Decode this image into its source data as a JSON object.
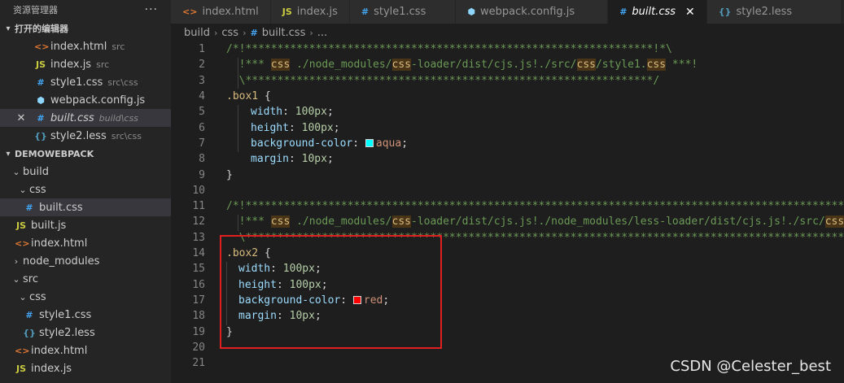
{
  "sidebar": {
    "title": "资源管理器",
    "more": "···",
    "open_editors_label": "打开的编辑器",
    "open_editors": [
      {
        "icon": "<>",
        "name": "index.html",
        "desc": "src"
      },
      {
        "icon": "JS",
        "name": "index.js",
        "desc": "src"
      },
      {
        "icon": "#",
        "name": "style1.css",
        "desc": "src\\css"
      },
      {
        "icon": "⬢",
        "name": "webpack.config.js",
        "desc": ""
      },
      {
        "icon": "#",
        "name": "built.css",
        "desc": "build\\css"
      },
      {
        "icon": "{}",
        "name": "style2.less",
        "desc": "src\\css"
      }
    ],
    "project_label": "DEMOWEBPACK",
    "tree": [
      {
        "name": "build"
      },
      {
        "name": "css"
      },
      {
        "name": "built.css",
        "icon": "#"
      },
      {
        "name": "built.js",
        "icon": "JS"
      },
      {
        "name": "index.html",
        "icon": "<>"
      },
      {
        "name": "node_modules"
      },
      {
        "name": "src"
      },
      {
        "name": "css"
      },
      {
        "name": "style1.css",
        "icon": "#"
      },
      {
        "name": "style2.less",
        "icon": "{}"
      },
      {
        "name": "index.html",
        "icon": "<>"
      },
      {
        "name": "index.js",
        "icon": "JS"
      }
    ]
  },
  "tabs": [
    {
      "icon": "<>",
      "label": "index.html"
    },
    {
      "icon": "JS",
      "label": "index.js"
    },
    {
      "icon": "#",
      "label": "style1.css"
    },
    {
      "icon": "⬢",
      "label": "webpack.config.js"
    },
    {
      "icon": "#",
      "label": "built.css",
      "close": "✕"
    },
    {
      "icon": "{}",
      "label": "style2.less"
    }
  ],
  "breadcrumb": {
    "p1": "build",
    "sep": "›",
    "p2": "css",
    "icon": "#",
    "p3": "built.css",
    "p4": "..."
  },
  "code": {
    "l1": "/*!****************************************************************!*\\",
    "l2a": "  !*** ",
    "l2b": "css",
    "l2c": " ./node_modules/",
    "l2d": "css",
    "l2e": "-loader/dist/cjs.js!./src/",
    "l2f": "css",
    "l2g": "/style1.",
    "l2h": "css",
    "l2i": " ***!",
    "l3": "  \\****************************************************************/",
    "l4sel": ".box1",
    "l4pun": " {",
    "l5p": "width",
    "l5v": "100px",
    "l6p": "height",
    "l6v": "100px",
    "l7p": "background-color",
    "l7v": "aqua",
    "l8p": "margin",
    "l8v": "10px",
    "l9": "}",
    "l11": "/*!*************************************************************************************************************",
    "l12a": "  !*** ",
    "l12b": "css",
    "l12c": " ./node_modules/",
    "l12d": "css",
    "l12e": "-loader/dist/cjs.js!./node_modules/less-loader/dist/cjs.js!./src/",
    "l12f": "css",
    "l12g": "/s",
    "l13": "  \\*************************************************************************************************************",
    "l14sel": ".box2",
    "l14pun": " {",
    "l15p": "width",
    "l15v": "100px",
    "l16p": "height",
    "l16v": "100px",
    "l17p": "background-color",
    "l17v": "red",
    "l18p": "margin",
    "l18v": "10px",
    "l19": "}",
    "colon": ": ",
    "semi": ";",
    "line_numbers": [
      "1",
      "2",
      "3",
      "4",
      "5",
      "6",
      "7",
      "8",
      "9",
      "10",
      "11",
      "12",
      "13",
      "14",
      "15",
      "16",
      "17",
      "18",
      "19",
      "20",
      "21"
    ]
  },
  "colors": {
    "aqua": "#00ffff",
    "red": "#ff0000",
    "box": "#e02020"
  },
  "watermark": "CSDN @Celester_best"
}
